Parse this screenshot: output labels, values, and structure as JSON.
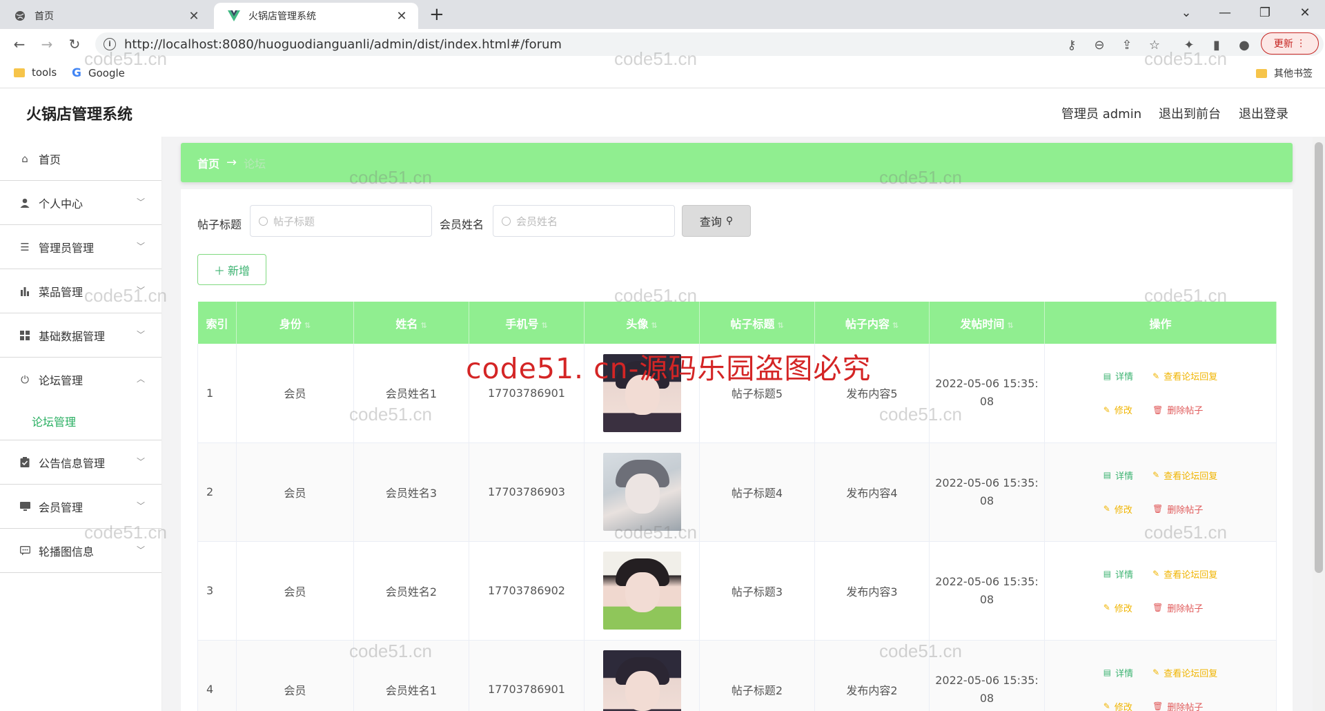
{
  "browser": {
    "tabs": [
      {
        "title": "首页",
        "active": false
      },
      {
        "title": "火锅店管理系统",
        "active": true
      }
    ],
    "url": "http://localhost:8080/huoguodianguanli/admin/dist/index.html#/forum",
    "update_label": "更新",
    "bookmarks": [
      "tools",
      "Google"
    ],
    "other_bookmarks": "其他书签"
  },
  "app": {
    "title": "火锅店管理系统",
    "user_label": "管理员 admin",
    "back_front": "退出到前台",
    "logout": "退出登录"
  },
  "sidebar": {
    "items": [
      {
        "label": "首页",
        "icon": "home-icon"
      },
      {
        "label": "个人中心",
        "icon": "user-icon"
      },
      {
        "label": "管理员管理",
        "icon": "list-icon"
      },
      {
        "label": "菜品管理",
        "icon": "bar-chart-icon"
      },
      {
        "label": "基础数据管理",
        "icon": "grid-icon"
      },
      {
        "label": "论坛管理",
        "icon": "power-icon",
        "expanded": true
      },
      {
        "label": "公告信息管理",
        "icon": "clipboard-icon"
      },
      {
        "label": "会员管理",
        "icon": "monitor-icon"
      },
      {
        "label": "轮播图信息",
        "icon": "chat-icon"
      }
    ],
    "submenu": {
      "label": "论坛管理"
    }
  },
  "breadcrumb": {
    "home": "首页",
    "arrow": "→",
    "current": "论坛"
  },
  "filters": {
    "title_label": "帖子标题",
    "title_placeholder": "帖子标题",
    "name_label": "会员姓名",
    "name_placeholder": "会员姓名",
    "search_label": "查询"
  },
  "add_label": "新增",
  "table": {
    "headers": [
      "索引",
      "身份",
      "姓名",
      "手机号",
      "头像",
      "帖子标题",
      "帖子内容",
      "发帖时间",
      "操作"
    ],
    "rows": [
      {
        "index": "1",
        "role": "会员",
        "name": "会员姓名1",
        "phone": "17703786901",
        "title": "帖子标题5",
        "content": "发布内容5",
        "time1": "2022-05-06 15:35:",
        "time2": "08"
      },
      {
        "index": "2",
        "role": "会员",
        "name": "会员姓名3",
        "phone": "17703786903",
        "title": "帖子标题4",
        "content": "发布内容4",
        "time1": "2022-05-06 15:35:",
        "time2": "08"
      },
      {
        "index": "3",
        "role": "会员",
        "name": "会员姓名2",
        "phone": "17703786902",
        "title": "帖子标题3",
        "content": "发布内容3",
        "time1": "2022-05-06 15:35:",
        "time2": "08"
      },
      {
        "index": "4",
        "role": "会员",
        "name": "会员姓名1",
        "phone": "17703786901",
        "title": "帖子标题2",
        "content": "发布内容2",
        "time1": "2022-05-06 15:35:",
        "time2": "08"
      }
    ],
    "actions": {
      "detail": "详情",
      "view_replies": "查看论坛回复",
      "edit": "修改",
      "delete": "删除帖子"
    }
  },
  "watermark": "code51.cn",
  "big_watermark": "code51. cn-源码乐园盗图必究",
  "colors": {
    "accent": "#90ee90",
    "link_green": "#3cb371",
    "warn": "#f0b400",
    "danger": "#e05a5a"
  }
}
